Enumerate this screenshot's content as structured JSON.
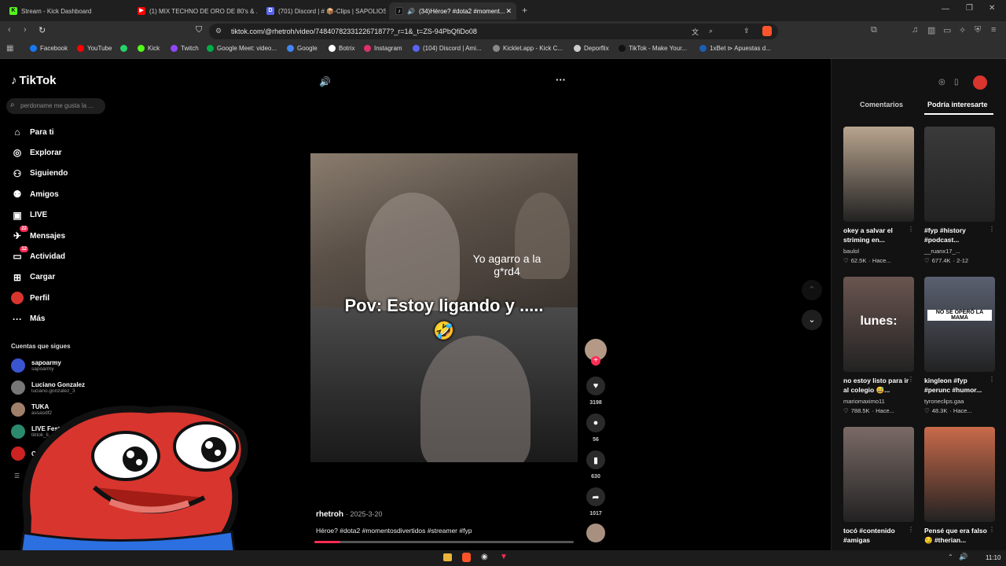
{
  "browser": {
    "tabs": [
      {
        "title": "Stream - Kick Dashboard",
        "color": "#53fc18",
        "glyph": "K"
      },
      {
        "title": "(1) MIX TECHNO DE ORO DE 80's & ...",
        "color": "#ff0000",
        "glyph": "▶"
      },
      {
        "title": "(701) Discord | # 📦-Clips | SAPOLIOS",
        "color": "#5865f2",
        "glyph": "D"
      },
      {
        "title": "(34)Héroe? #dota2 #moment...",
        "color": "#111111",
        "glyph": "♪"
      }
    ],
    "url": "tiktok.com/@rhetroh/video/7484078233122671877?_r=1&_t=ZS-94PbQfiDo08",
    "bookmarks": [
      {
        "label": "Facebook",
        "color": "#1877f2"
      },
      {
        "label": "YouTube",
        "color": "#ff0000"
      },
      {
        "label": "",
        "color": "#25d366"
      },
      {
        "label": "Kick",
        "color": "#53fc18"
      },
      {
        "label": "Twitch",
        "color": "#9146ff"
      },
      {
        "label": "Google Meet: video...",
        "color": "#00ac47"
      },
      {
        "label": "Google",
        "color": "#4285f4"
      },
      {
        "label": "Botrix",
        "color": "#ffffff"
      },
      {
        "label": "Instagram",
        "color": "#e1306c"
      },
      {
        "label": "(104) Discord | Ami...",
        "color": "#5865f2"
      },
      {
        "label": "Kicklet.app - Kick C...",
        "color": "#888888"
      },
      {
        "label": "Deporflix",
        "color": "#cccccc"
      },
      {
        "label": "TikTok - Make Your...",
        "color": "#111111"
      },
      {
        "label": "1xBet ⊳ Apuestas d...",
        "color": "#1a5fb4"
      }
    ]
  },
  "tiktok": {
    "logo": "TikTok",
    "search_placeholder": "perdoname me gusta la ...",
    "nav": [
      {
        "label": "Para ti",
        "icon": "home-icon",
        "glyph": "⌂"
      },
      {
        "label": "Explorar",
        "icon": "compass-icon",
        "glyph": "◎"
      },
      {
        "label": "Siguiendo",
        "icon": "following-icon",
        "glyph": "⚇"
      },
      {
        "label": "Amigos",
        "icon": "friends-icon",
        "glyph": "⚉"
      },
      {
        "label": "LIVE",
        "icon": "live-icon",
        "glyph": "▣"
      },
      {
        "label": "Mensajes",
        "icon": "messages-icon",
        "glyph": "✈",
        "badge": "22"
      },
      {
        "label": "Actividad",
        "icon": "activity-icon",
        "glyph": "▭",
        "badge": "12"
      },
      {
        "label": "Cargar",
        "icon": "upload-icon",
        "glyph": "⊞"
      },
      {
        "label": "Perfil",
        "icon": "profile-avatar-icon",
        "glyph": ""
      },
      {
        "label": "Más",
        "icon": "more-icon",
        "glyph": "···"
      }
    ],
    "following_title": "Cuentas que sigues",
    "following": [
      {
        "name": "sapoarmy",
        "handle": "sapoarmy",
        "color": "#3a55d0"
      },
      {
        "name": "Luciano Gonzalez",
        "handle": "luciano.gonzalez_3",
        "color": "#777777"
      },
      {
        "name": "TUKA",
        "handle": "assasdf2",
        "color": "#a0806a"
      },
      {
        "name": "LIVE Fest S...",
        "handle": "tiktok_li...",
        "color": "#2b8a6e"
      },
      {
        "name": "C I",
        "handle": "",
        "color": "#cc2222"
      }
    ],
    "video": {
      "caption_overlay": "Pov: Estoy ligando y ..... 🤣",
      "small_overlay": "Yo agarro a la g*rd4",
      "author": "rhetroh",
      "date": "· 2025-3-20",
      "description": "Héroe? #dota2 #momentosdivertidos #streamer #fyp",
      "progress": 0.1
    },
    "actions": [
      {
        "icon": "heart-icon",
        "glyph": "♥",
        "count": "3198"
      },
      {
        "icon": "comment-icon",
        "glyph": "●",
        "count": "56"
      },
      {
        "icon": "bookmark-icon",
        "glyph": "▮",
        "count": "630"
      },
      {
        "icon": "share-icon",
        "glyph": "➦",
        "count": "1017"
      }
    ],
    "panel_tabs": [
      "Comentarios",
      "Podría interesarte"
    ],
    "recommendations": [
      {
        "caption": "okey a salvar el striming en...",
        "author": "baulol",
        "likes": "62.5K",
        "when": "· Hace...",
        "color": "#b8a48e",
        "overlay": ""
      },
      {
        "caption": "#fyp #history #podcast...",
        "author": "__ruanx17_...",
        "likes": "677.4K",
        "when": "· 2-12",
        "color": "#3a3a3a",
        "overlay": ""
      },
      {
        "caption": "no estoy listo para ir al colegio 😅...",
        "author": "mariomaximo11",
        "likes": "788.5K",
        "when": "· Hace...",
        "color": "#6a5550",
        "overlay": "lunes:"
      },
      {
        "caption": "kingleon #fyp #perunc #humor...",
        "author": "tyroneclips.gaa",
        "likes": "48.3K",
        "when": "· Hace...",
        "color": "#5a6070",
        "overlay": "NO SE OPERÓ LA MAMÁ"
      },
      {
        "caption": "tocó #contenido #amigas",
        "author": "",
        "likes": "",
        "when": "",
        "color": "#7a6a66",
        "overlay": ""
      },
      {
        "caption": "Pensé que era falso😏 #therian...",
        "author": "",
        "likes": "",
        "when": "",
        "color": "#c96a4a",
        "overlay": ""
      }
    ]
  },
  "taskbar": {
    "time": "11:10"
  }
}
